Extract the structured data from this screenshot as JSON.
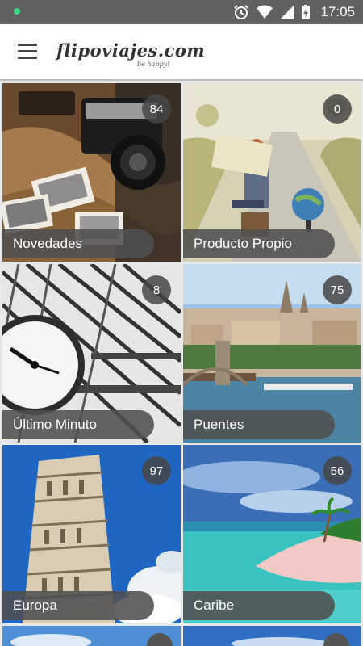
{
  "status_bar": {
    "time": "17:05"
  },
  "app_bar": {
    "logo_text": "flipoviajes.com",
    "logo_tagline": "be happy!"
  },
  "categories": [
    {
      "label": "Novedades",
      "count": "84"
    },
    {
      "label": "Producto Propio",
      "count": "0"
    },
    {
      "label": "Último Minuto",
      "count": "8"
    },
    {
      "label": "Puentes",
      "count": "75"
    },
    {
      "label": "Europa",
      "count": "97"
    },
    {
      "label": "Caribe",
      "count": "56"
    }
  ]
}
